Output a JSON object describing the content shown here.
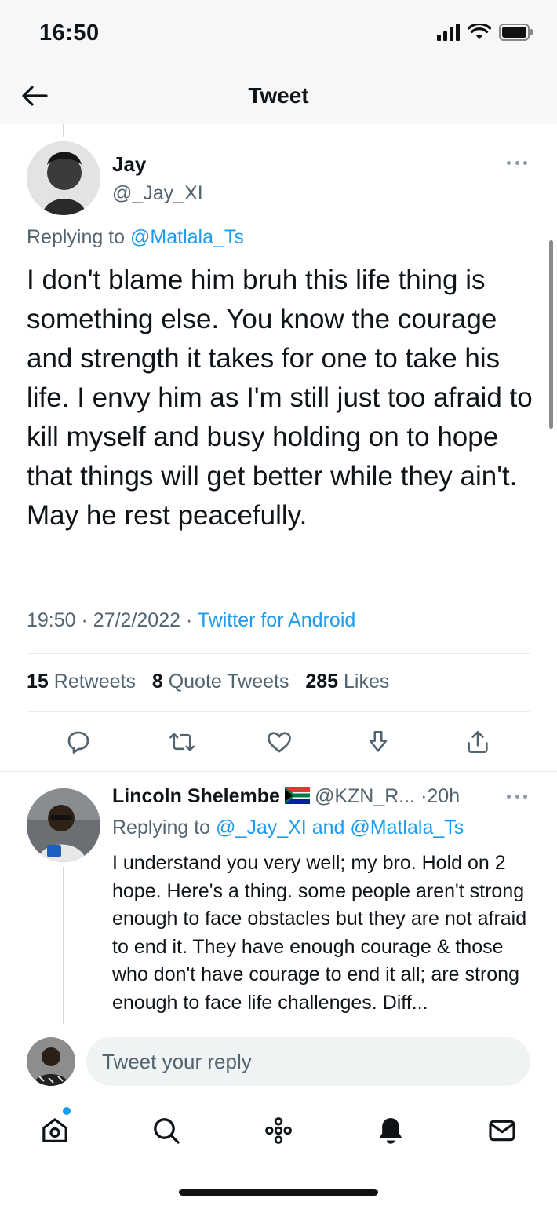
{
  "status_bar": {
    "time": "16:50"
  },
  "header": {
    "title": "Tweet"
  },
  "tweet": {
    "author_name": "Jay",
    "author_handle": "@_Jay_XI",
    "replying_prefix": "Replying to",
    "replying_to": "@Matlala_Ts",
    "text": "I don't blame him bruh this life thing is something else. You know the courage and strength it takes for one to take his life. I envy him as I'm still just too afraid to kill myself and busy holding on to hope that things will get better while they ain't. May he rest peacefully.",
    "time": "19:50",
    "date": "27/2/2022",
    "source": "Twitter for Android",
    "retweets_count": "15",
    "retweets_label": "Retweets",
    "quote_count": "8",
    "quote_label": "Quote Tweets",
    "likes_count": "285",
    "likes_label": "Likes"
  },
  "reply": {
    "author_name": "Lincoln Shelembe",
    "author_handle": "@KZN_R...",
    "age": "20h",
    "replying_prefix": "Replying to",
    "replying_to_1": "@_Jay_XI",
    "replying_and": "and",
    "replying_to_2": "@Matlala_Ts",
    "text": "I understand you very well; my bro. Hold on 2 hope. Here's a thing. some people aren't strong enough to face obstacles but they are not afraid to end it. They have enough courage & those who don't have courage to end it all; are strong enough to face life challenges. Diff..."
  },
  "compose": {
    "placeholder": "Tweet your reply"
  },
  "icons": {
    "back": "arrow-left-icon",
    "more": "more-horizontal-icon",
    "actions": [
      "reply-icon",
      "retweet-icon",
      "like-icon",
      "bookmark-icon",
      "share-icon"
    ],
    "nav": [
      "home-icon",
      "search-icon",
      "spaces-icon",
      "notifications-icon",
      "messages-icon"
    ]
  },
  "colors": {
    "accent": "#1d9bf0",
    "text": "#0f1419",
    "muted": "#536471",
    "divider": "#e6ecf0"
  }
}
